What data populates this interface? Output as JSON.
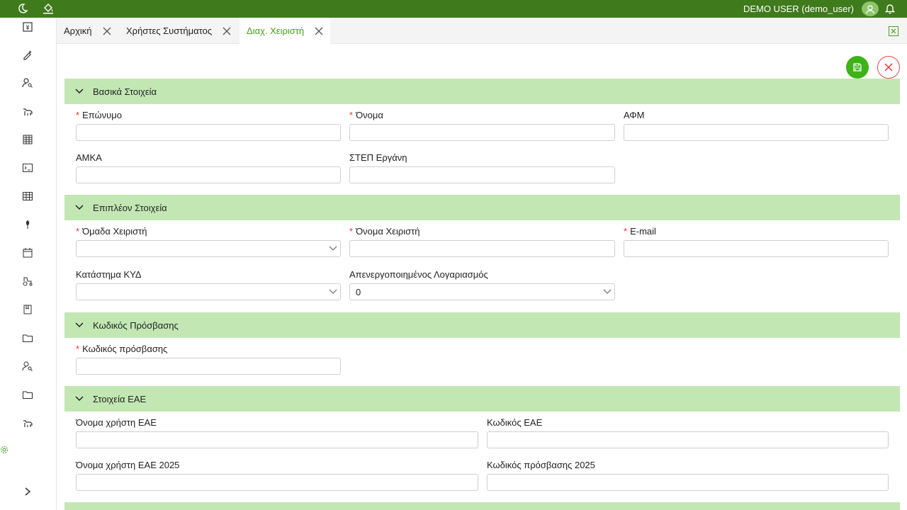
{
  "topbar": {
    "user_label": "DEMO USER (demo_user)",
    "icons": [
      "moon-icon",
      "paint-bucket-icon",
      "avatar-icon",
      "bell-icon"
    ],
    "color": "#3f7a1c"
  },
  "sidebar": {
    "icons": [
      "calculator-icon",
      "syringe-icon",
      "user-search-icon",
      "cow-icon",
      "building-icon",
      "terminal-icon",
      "table-icon",
      "leaf-icon",
      "calendar-icon",
      "tractor-icon",
      "book-icon",
      "folder-icon",
      "users-search-icon",
      "folder-open-icon",
      "cow-icon-2"
    ],
    "expand_icon": "chevron-right-icon",
    "settings_icon": "gear-icon"
  },
  "tabs": [
    {
      "label": "Αρχική",
      "active": false
    },
    {
      "label": "Χρήστες Συστήματος",
      "active": false
    },
    {
      "label": "Διαχ. Χειριστή",
      "active": true
    }
  ],
  "sections": {
    "basic": {
      "title": "Βασικά Στοιχεία",
      "surname_label": "Επώνυμο",
      "name_label": "Όνομα",
      "afm_label": "ΑΦΜ",
      "amka_label": "ΑΜΚΑ",
      "step_label": "ΣΤΕΠ Εργάνη"
    },
    "extra": {
      "title": "Επιπλέον Στοιχεία",
      "group_label": "Όμαδα Χειριστή",
      "username_label": "Όνομα Χειριστή",
      "email_label": "E-mail",
      "store_label": "Κατάστημα ΚΥΔ",
      "disabled_label": "Απενεργοποιημένος Λογαριασμός",
      "disabled_value": "0"
    },
    "password": {
      "title": "Κωδικός Πρόσβασης",
      "password_label": "Κωδικός πρόσβασης"
    },
    "eae": {
      "title": "Στοιχεία ΕΑΕ",
      "eae_user_label": "Όνομα χρήστη ΕΑΕ",
      "eae_code_label": "Κωδικός ΕΑΕ",
      "eae_user_2025_label": "Όνομα χρήστη ΕΑΕ 2025",
      "eae_pass_2025_label": "Κωδικός πρόσβασης 2025"
    }
  },
  "required_mark": "*",
  "colors": {
    "section_bg": "#c2e7b3",
    "accent": "#45a21a",
    "required": "#e33"
  }
}
